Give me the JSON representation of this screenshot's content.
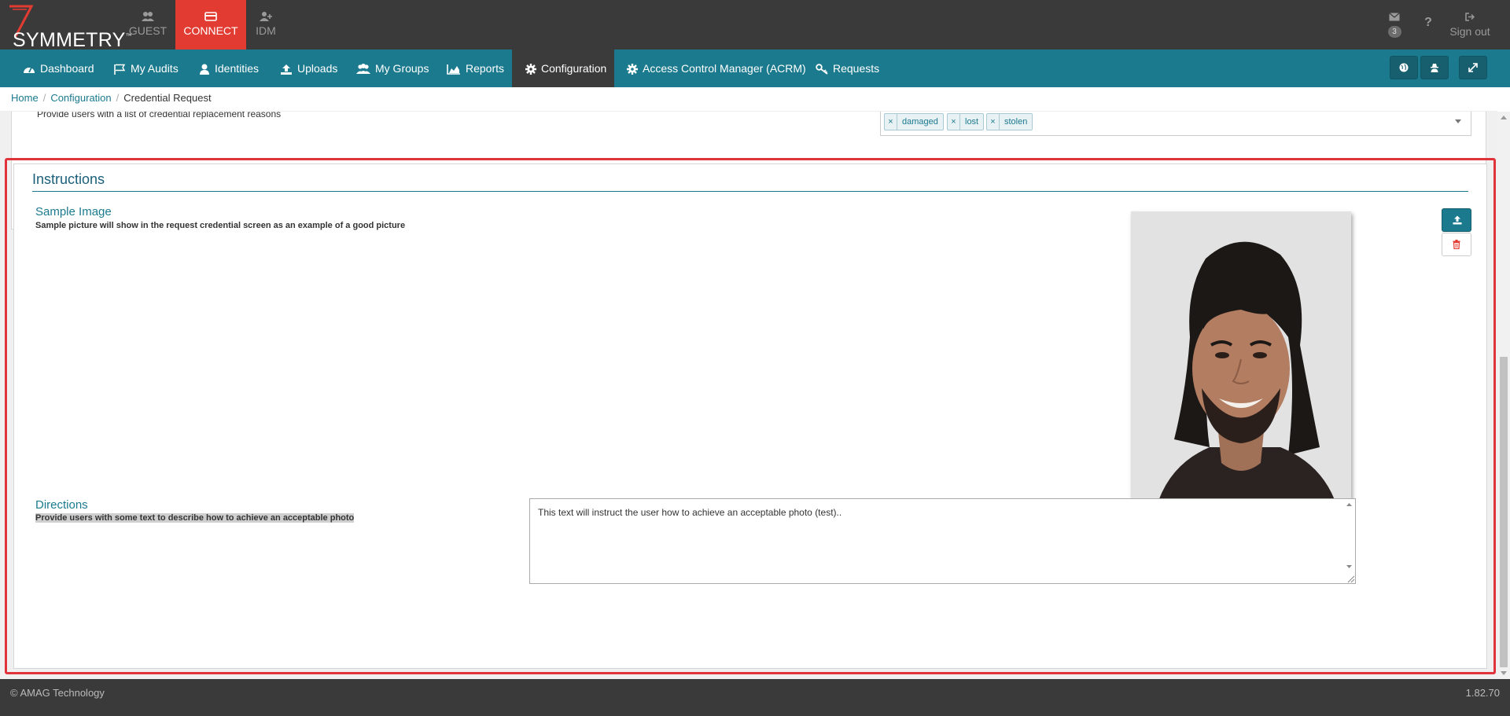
{
  "brand": {
    "name": "SYMMETRY",
    "tm": "™"
  },
  "modules": {
    "guest": "GUEST",
    "connect": "CONNECT",
    "idm": "IDM"
  },
  "header": {
    "mail_count": "3",
    "help": "?",
    "sign_out": "Sign out"
  },
  "nav": {
    "items": [
      {
        "label": "Dashboard",
        "icon": "dashboard-icon"
      },
      {
        "label": "My Audits",
        "icon": "flag-icon"
      },
      {
        "label": "Identities",
        "icon": "user-icon"
      },
      {
        "label": "Uploads",
        "icon": "upload-icon"
      },
      {
        "label": "My Groups",
        "icon": "group-icon"
      },
      {
        "label": "Reports",
        "icon": "area-chart-icon"
      },
      {
        "label": "Configuration",
        "icon": "gear-icon"
      },
      {
        "label": "Access Control Manager (ACRM)",
        "icon": "gear-icon"
      },
      {
        "label": "Requests",
        "icon": "key-icon"
      }
    ],
    "active": "Configuration",
    "right_buttons": [
      "globe-icon",
      "user-secret-icon",
      "expand-icon"
    ]
  },
  "breadcrumb": {
    "home": "Home",
    "configuration": "Configuration",
    "current": "Credential Request"
  },
  "replacement": {
    "description": "Provide users with a list of credential replacement reasons",
    "tags": [
      "damaged",
      "lost",
      "stolen"
    ],
    "remove_glyph": "×"
  },
  "instructions": {
    "title": "Instructions",
    "sample_image": {
      "title": "Sample Image",
      "description": "Sample picture will show in the request credential screen as an example of a good picture"
    },
    "directions": {
      "title": "Directions",
      "description": "Provide users with some text to describe how to achieve an acceptable photo",
      "value": "This text will instruct the user how to achieve an acceptable photo (test).."
    }
  },
  "footer": {
    "copyright": "© AMAG Technology",
    "version": "1.82.70"
  },
  "colors": {
    "teal": "#1b7a8e",
    "red": "#e23b32",
    "dark": "#3a3a3a"
  }
}
